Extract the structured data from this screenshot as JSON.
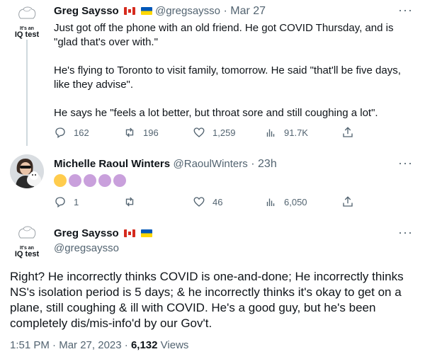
{
  "tweet1": {
    "logo": {
      "tag": "It's an",
      "main": "IQ test"
    },
    "name": "Greg Saysso",
    "handle": "@gregsaysso",
    "sep": "·",
    "time": "Mar 27",
    "text": "Just got off the phone with an old friend. He got COVID Thursday, and is \"glad that's over with.\"\n\nHe's flying to Toronto to visit family, tomorrow. He said \"that'll be five days, like they advise\".\n\nHe says he \"feels a lot better, but throat sore and still coughing a lot\".",
    "replies": "162",
    "retweets": "196",
    "likes": "1,259",
    "views": "91.7K"
  },
  "tweet2": {
    "name": "Michelle Raoul Winters",
    "handle": "@RaoulWinters",
    "sep": "·",
    "time": "23h",
    "emojis": [
      "disappointed-face",
      "woman-facepalming",
      "woman-facepalming",
      "woman-facepalming",
      "woman-facepalming"
    ],
    "replies": "1",
    "retweets": "",
    "likes": "46",
    "views": "6,050"
  },
  "tweet3": {
    "logo": {
      "tag": "It's an",
      "main": "IQ test"
    },
    "name": "Greg Saysso",
    "handle": "@gregsaysso",
    "text": "Right? He incorrectly thinks COVID is one-and-done; He incorrectly thinks NS's isolation period is 5 days; & he incorrectly thinks it's okay to get on a plane, still coughing & ill with COVID. He's a good guy, but he's been completely dis/mis-info'd by our Gov't.",
    "time": "1:51 PM",
    "sep": "·",
    "date": "Mar 27, 2023",
    "views_count": "6,132",
    "views_label": "Views"
  },
  "more_glyph": "···",
  "colors": {
    "text": "#0f1419",
    "muted": "#536471",
    "line": "#cfd9de",
    "accent": "#1d9bf0"
  }
}
